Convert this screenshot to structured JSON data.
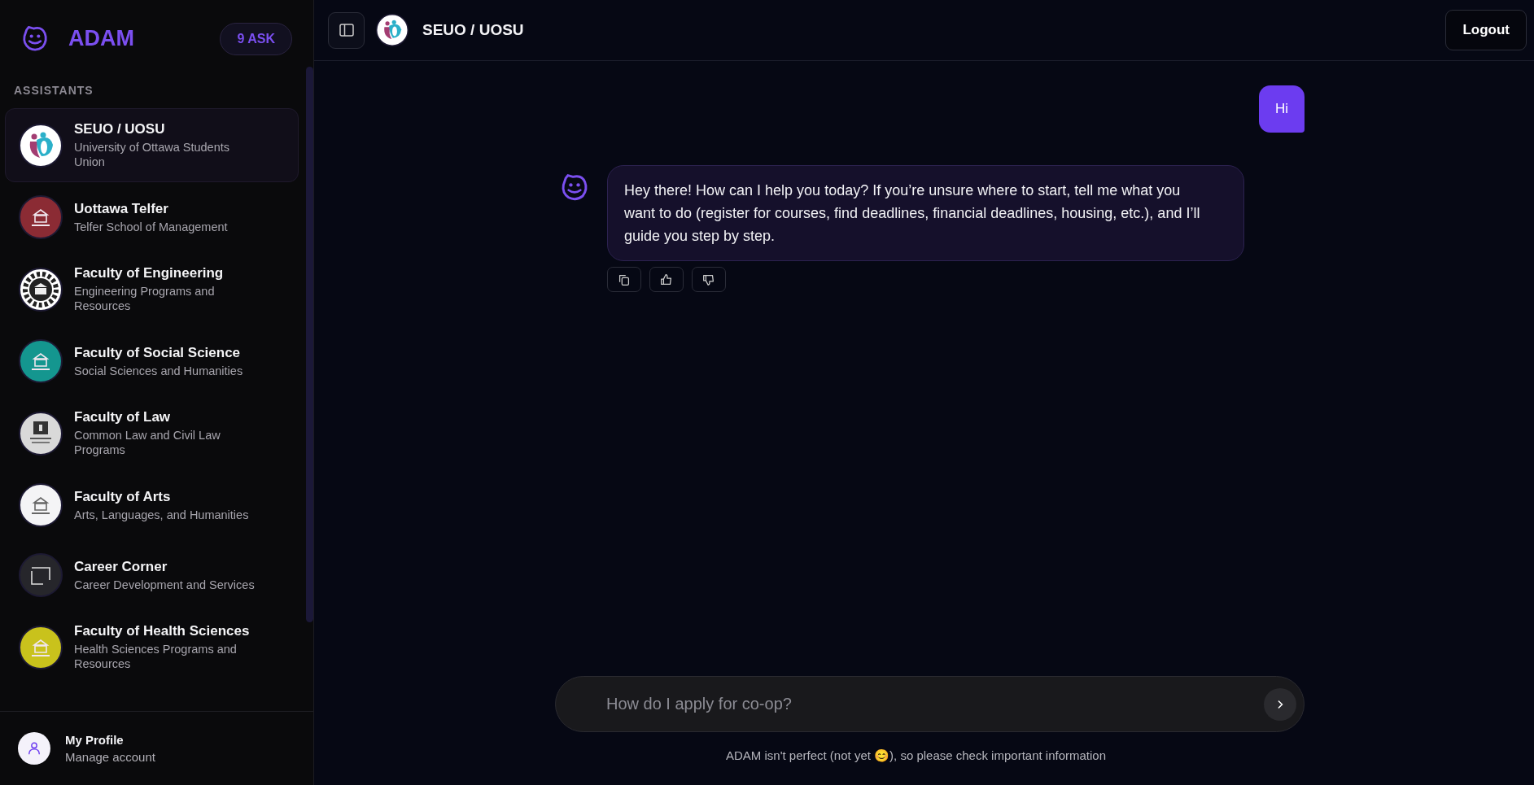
{
  "sidebar": {
    "brand": "ADAM",
    "ask_badge": "9 ASK",
    "section_label": "ASSISTANTS",
    "assistants": [
      {
        "name": "SEUO / UOSU",
        "description": "University of Ottawa Students Union",
        "selected": true,
        "kind": "figures",
        "color": "#ffffff"
      },
      {
        "name": "Uottawa Telfer",
        "description": "Telfer School of Management",
        "selected": false,
        "kind": "building",
        "color": "#8b2b34"
      },
      {
        "name": "Faculty of Engineering",
        "description": "Engineering Programs and Resources",
        "selected": false,
        "kind": "gear",
        "color": "#ffffff"
      },
      {
        "name": "Faculty of Social Science",
        "description": "Social Sciences and Humanities",
        "selected": false,
        "kind": "building",
        "color": "#14968f"
      },
      {
        "name": "Faculty of Law",
        "description": "Common Law and Civil Law Programs",
        "selected": false,
        "kind": "tower",
        "color": "#d9d9d9"
      },
      {
        "name": "Faculty of Arts",
        "description": "Arts, Languages, and Humanities",
        "selected": false,
        "kind": "building",
        "color": "#f4f4f6"
      },
      {
        "name": "Career Corner",
        "description": "Career Development and Services",
        "selected": false,
        "kind": "frame",
        "color": "#26262b"
      },
      {
        "name": "Faculty of Health Sciences",
        "description": "Health Sciences Programs and Resources",
        "selected": false,
        "kind": "building",
        "color": "#c9c21c"
      }
    ],
    "profile": {
      "name": "My Profile",
      "subtitle": "Manage account"
    }
  },
  "header": {
    "title": "SEUO / UOSU",
    "logout": "Logout"
  },
  "messages": [
    {
      "kind": "user",
      "text": "Hi"
    },
    {
      "kind": "assistant",
      "text": "Hey there! How can I help you today? If you’re unsure where to start, tell me what you want to do (register for courses, find deadlines, financial deadlines, housing, etc.), and I’ll guide you step by step."
    }
  ],
  "composer": {
    "placeholder": "How do I apply for co-op?"
  },
  "disclaimer": "ADAM isn't perfect (not yet 😊), so please check important information"
}
